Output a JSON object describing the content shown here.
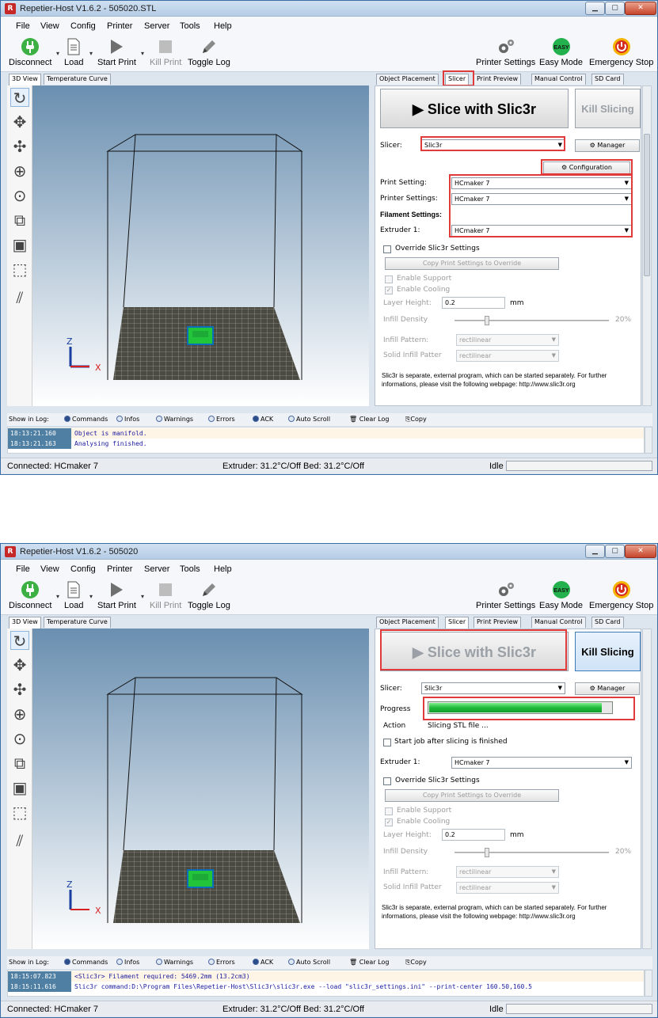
{
  "menu": [
    "File",
    "View",
    "Config",
    "Printer",
    "Server",
    "Tools",
    "Help"
  ],
  "toolbar": {
    "disconnect": "Disconnect",
    "load": "Load",
    "start_print": "Start Print",
    "kill_print": "Kill Print",
    "toggle_log": "Toggle Log",
    "printer_settings": "Printer Settings",
    "easy_mode": "Easy Mode",
    "easy_badge": "EASY",
    "emergency_stop": "Emergency Stop"
  },
  "left_tabs": [
    "3D View",
    "Temperature Curve"
  ],
  "right_tabs": [
    "Object Placement",
    "Slicer",
    "Print Preview",
    "Manual Control",
    "SD Card"
  ],
  "axes": {
    "z": "Z",
    "x": "X"
  },
  "log_filters": [
    "Show in Log:",
    "Commands",
    "Infos",
    "Warnings",
    "Errors",
    "ACK",
    "Auto Scroll",
    "Clear Log",
    "Copy"
  ],
  "status": {
    "connected": "Connected: HCmaker 7",
    "temps": "Extruder: 31.2°C/Off Bed: 31.2°C/Off",
    "state": "Idle"
  },
  "common": {
    "slice_with": "Slice with Slic3r",
    "kill_slicing": "Kill Slicing",
    "slicer_label": "Slicer:",
    "slicer_value": "Slic3r",
    "manager": "Manager",
    "extruder_label": "Extruder 1:",
    "extruder_value": "HCmaker 7",
    "override": "Override Slic3r Settings",
    "copy_print": "Copy Print Settings to Override",
    "enable_support": "Enable Support",
    "enable_cooling": "Enable Cooling",
    "layer_height_label": "Layer Height:",
    "layer_height": "0.2",
    "mm": "mm",
    "infill_density_label": "Infill Density",
    "infill_density": "20%",
    "infill_pattern_label": "Infill Pattern:",
    "infill_pattern": "rectilinear",
    "solid_infill_label": "Solid Infill Patter",
    "solid_infill": "rectilinear",
    "info_text": "Slic3r is separate, external program, which can be started separately. For further informations, please visit the following webpage: http://www.slic3r.org"
  },
  "shot1": {
    "title": "Repetier-Host V1.6.2 - 505020.STL",
    "configuration": "Configuration",
    "print_setting_label": "Print Setting:",
    "print_setting": "HCmaker 7",
    "printer_settings_label": "Printer Settings:",
    "printer_settings": "HCmaker 7",
    "filament_label": "Filament Settings:",
    "log": [
      {
        "time": "18:13:21.160",
        "msg": "Object is manifold."
      },
      {
        "time": "18:13:21.163",
        "msg": "Analysing finished."
      }
    ]
  },
  "shot2": {
    "title": "Repetier-Host V1.6.2 - 505020",
    "progress_label": "Progress",
    "progress": 0.95,
    "action_label": "Action",
    "action_value": "Slicing STL file ...",
    "start_job": "Start job after slicing is finished",
    "log": [
      {
        "time": "18:15:07.823",
        "msg": "<Slic3r> Filament required: 5469.2mm (13.2cm3)"
      },
      {
        "time": "18:15:11.616",
        "msg": "Slic3r command:D:\\Program Files\\Repetier-Host\\Slic3r\\slic3r.exe --load \"slic3r_settings.ini\" --print-center 160.50,160.5"
      }
    ]
  }
}
